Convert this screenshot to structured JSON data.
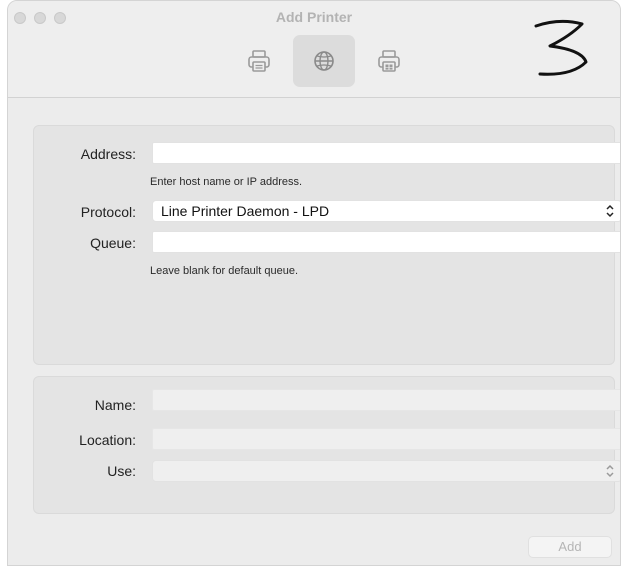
{
  "window": {
    "title": "Add Printer",
    "toolbar": [
      {
        "icon": "printer-icon",
        "selected": false
      },
      {
        "icon": "globe-icon",
        "selected": true
      },
      {
        "icon": "printer-server-icon",
        "selected": false
      }
    ]
  },
  "ip_panel": {
    "address_label": "Address:",
    "address_value": "",
    "address_hint": "Enter host name or IP address.",
    "protocol_label": "Protocol:",
    "protocol_value": "Line Printer Daemon - LPD",
    "queue_label": "Queue:",
    "queue_value": "",
    "queue_hint": "Leave blank for default queue."
  },
  "info_panel": {
    "name_label": "Name:",
    "name_value": "",
    "location_label": "Location:",
    "location_value": "",
    "use_label": "Use:",
    "use_value": ""
  },
  "footer": {
    "add_label": "Add"
  },
  "annotation": {
    "text": "3"
  }
}
